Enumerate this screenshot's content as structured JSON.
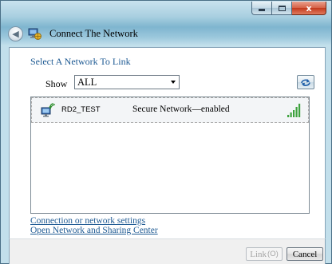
{
  "window": {
    "title": "Connect The Network",
    "caption_buttons": [
      "minimize",
      "maximize",
      "close"
    ],
    "close_glyph": "x"
  },
  "navigation": {
    "back_icon": "back-arrow-icon",
    "app_icon": "network-globe-icon"
  },
  "main": {
    "heading": "Select A Network To Link",
    "filter": {
      "label": "Show",
      "selected": "ALL"
    },
    "refresh_icon": "refresh-icon",
    "networks": [
      {
        "name": "RD2_TEST",
        "status": "Secure Network—enabled",
        "icon": "wireless-network-icon",
        "signal_icon": "signal-strength-icon",
        "signal_bars": 5
      }
    ],
    "links": {
      "connection_settings": "Connection or network settings",
      "sharing_center": "Open Network and Sharing Center"
    }
  },
  "footer": {
    "link_button": "Link",
    "link_accelerator": "(O)",
    "cancel_button": "Cancel"
  },
  "colors": {
    "link_text": "#1e5a93",
    "title_bar": "#a9cfe0",
    "close_button": "#c23a1e",
    "signal_green": "#3ea23e"
  }
}
